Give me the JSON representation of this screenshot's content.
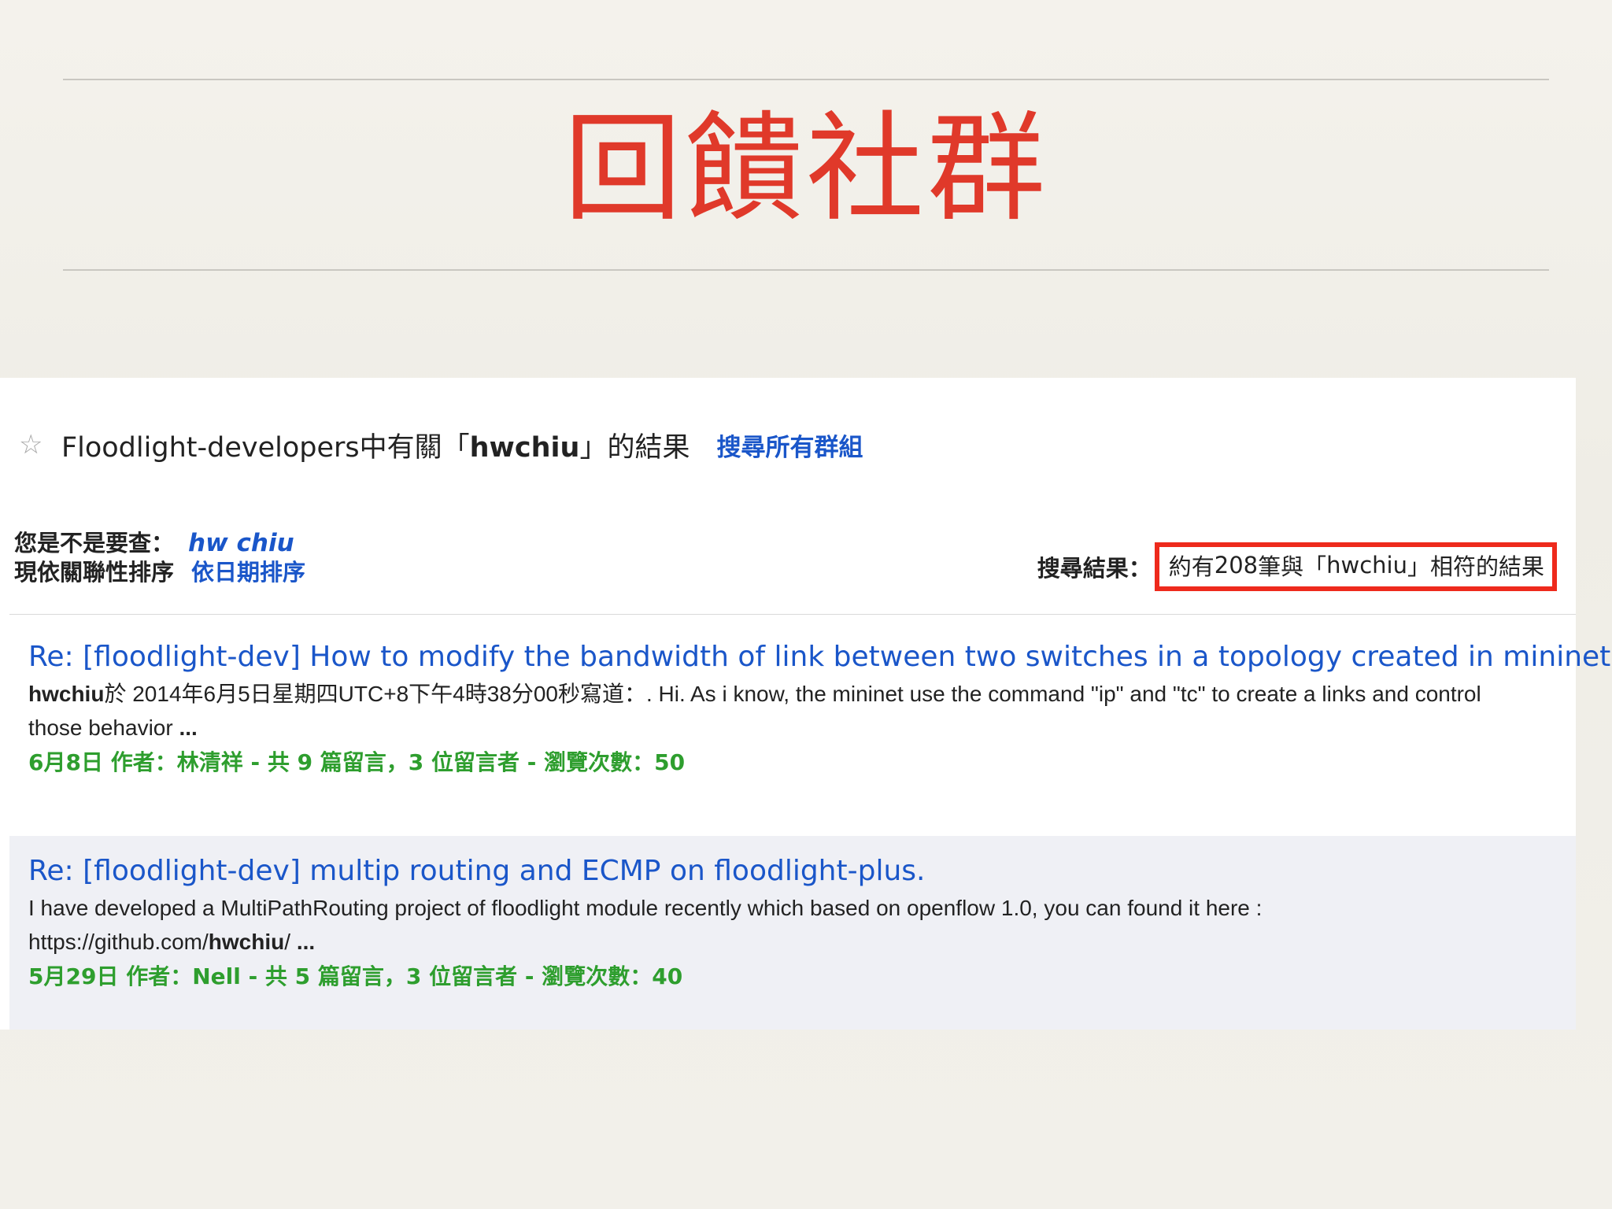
{
  "slide": {
    "title": "回饋社群"
  },
  "group": {
    "title_prefix": "Floodlight-developers中有關「",
    "query": "hwchiu",
    "title_suffix": "」的結果",
    "all_groups_link": "搜尋所有群組"
  },
  "suggestion": {
    "label": "您是不是要查：",
    "link": "hw chiu"
  },
  "sort": {
    "label": "現依關聯性排序",
    "link": "依日期排序"
  },
  "summary": {
    "label": "搜尋結果：",
    "prefix": "約有 ",
    "count": "208",
    "middle": " 筆與「",
    "query": "hwchiu",
    "suffix": "」相符的結果"
  },
  "results": [
    {
      "title": "Re: [floodlight-dev] How to modify the bandwidth of link between two switches in a topology created in mininet.",
      "snippet_author": "hwchiu",
      "snippet_rest": "於 2014年6月5日星期四UTC+8下午4時38分00秒寫道：. Hi. As i know, the mininet use the command \"ip\" and \"tc\" to create a links and control those behavior ",
      "snippet_ellipsis": "...",
      "meta": "6月8日 作者：林清祥 - 共 9 篇留言，3 位留言者 - 瀏覽次數：50"
    },
    {
      "title": "Re: [floodlight-dev] multip routing and ECMP on floodlight-plus.",
      "snippet_start": "I have developed a MultiPathRouting project of floodlight module recently which based on openflow 1.0, you can found it here : https://github.com/",
      "snippet_bold": "hwchiu",
      "snippet_end": "/ ",
      "snippet_ellipsis": "...",
      "meta": "5月29日 作者：Nell - 共 5 篇留言，3 位留言者 - 瀏覽次數：40"
    }
  ],
  "colors": {
    "title_red": "#e0392a",
    "link_blue": "#1a56c9",
    "meta_green": "#2e9e2e",
    "highlight_red": "#ee2a1c"
  },
  "icons": {
    "star": "star-icon"
  }
}
